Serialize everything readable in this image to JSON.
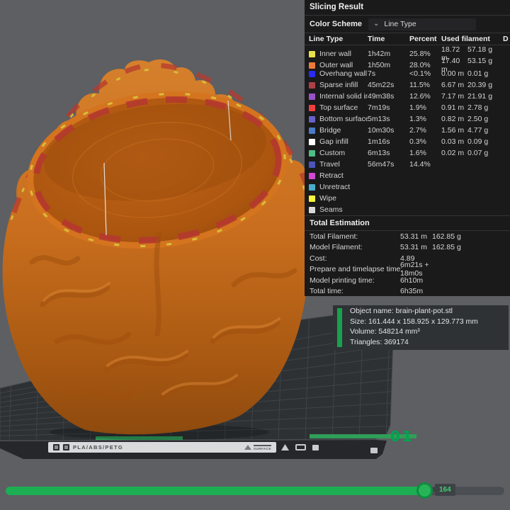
{
  "panel": {
    "title": "Slicing Result",
    "color_scheme_label": "Color Scheme",
    "color_scheme_value": "Line Type",
    "table": {
      "headers": [
        "Line Type",
        "Time",
        "Percent",
        "Used filament",
        "D"
      ],
      "rows": [
        {
          "label": "Inner wall",
          "color": "#E8E14C",
          "time": "1h42m",
          "percent": "25.8%",
          "filament_m": "18.72 m",
          "filament_g": "57.18 g"
        },
        {
          "label": "Outer wall",
          "color": "#ED7A38",
          "time": "1h50m",
          "percent": "28.0%",
          "filament_m": "17.40 m",
          "filament_g": "53.15 g"
        },
        {
          "label": "Overhang wall",
          "color": "#2A2AF0",
          "time": "7s",
          "percent": "<0.1%",
          "filament_m": "0.00 m",
          "filament_g": "0.01 g"
        },
        {
          "label": "Sparse infill",
          "color": "#AC4046",
          "time": "45m22s",
          "percent": "11.5%",
          "filament_m": "6.67 m",
          "filament_g": "20.39 g"
        },
        {
          "label": "Internal solid infill",
          "color": "#9953C8",
          "time": "49m38s",
          "percent": "12.6%",
          "filament_m": "7.17 m",
          "filament_g": "21.91 g"
        },
        {
          "label": "Top surface",
          "color": "#EE4040",
          "time": "7m19s",
          "percent": "1.9%",
          "filament_m": "0.91 m",
          "filament_g": "2.78 g"
        },
        {
          "label": "Bottom surface",
          "color": "#6562C9",
          "time": "5m13s",
          "percent": "1.3%",
          "filament_m": "0.82 m",
          "filament_g": "2.50 g"
        },
        {
          "label": "Bridge",
          "color": "#4C7AC6",
          "time": "10m30s",
          "percent": "2.7%",
          "filament_m": "1.56 m",
          "filament_g": "4.77 g"
        },
        {
          "label": "Gap infill",
          "color": "#FFFFFF",
          "time": "1m16s",
          "percent": "0.3%",
          "filament_m": "0.03 m",
          "filament_g": "0.09 g"
        },
        {
          "label": "Custom",
          "color": "#4FBE85",
          "time": "6m13s",
          "percent": "1.6%",
          "filament_m": "0.02 m",
          "filament_g": "0.07 g"
        },
        {
          "label": "Travel",
          "color": "#4B55BE",
          "time": "56m47s",
          "percent": "14.4%",
          "filament_m": "",
          "filament_g": ""
        },
        {
          "label": "Retract",
          "color": "#D347D3",
          "time": "",
          "percent": "",
          "filament_m": "",
          "filament_g": ""
        },
        {
          "label": "Unretract",
          "color": "#48AECB",
          "time": "",
          "percent": "",
          "filament_m": "",
          "filament_g": ""
        },
        {
          "label": "Wipe",
          "color": "#F6F63A",
          "time": "",
          "percent": "",
          "filament_m": "",
          "filament_g": ""
        },
        {
          "label": "Seams",
          "color": "#D9D9D9",
          "time": "",
          "percent": "",
          "filament_m": "",
          "filament_g": ""
        }
      ]
    },
    "total_estimation": {
      "title": "Total Estimation",
      "rows": [
        {
          "label": "Total Filament:",
          "value": "53.31 m",
          "value2": "162.85 g"
        },
        {
          "label": "Model Filament:",
          "value": "53.31 m",
          "value2": "162.85 g"
        },
        {
          "label": "Cost:",
          "value": "4.89",
          "value2": ""
        },
        {
          "label": "Prepare and timelapse time:",
          "value": "6m21s + 18m0s",
          "value2": ""
        },
        {
          "label": "Model printing time:",
          "value": "6h10m",
          "value2": ""
        },
        {
          "label": "Total time:",
          "value": "6h35m",
          "value2": ""
        }
      ]
    }
  },
  "tooltip": {
    "lines": [
      "Object name: brain-plant-pot.stl",
      "Size: 161.444 x 158.925 x 129.773 mm",
      "Volume: 548214 mm³",
      "Triangles: 369174"
    ]
  },
  "plate": {
    "number": "01",
    "strip_label": "PLA/ABS/PETG",
    "surface_label": "SURFACE"
  },
  "slider": {
    "value": "164"
  },
  "colors": {
    "accent_green": "#17A24B",
    "panel_bg": "#1A1A1B",
    "viewport_bg": "#5D5F63",
    "plate_bg": "#2E3134",
    "model_orange": "#C96E1E"
  }
}
